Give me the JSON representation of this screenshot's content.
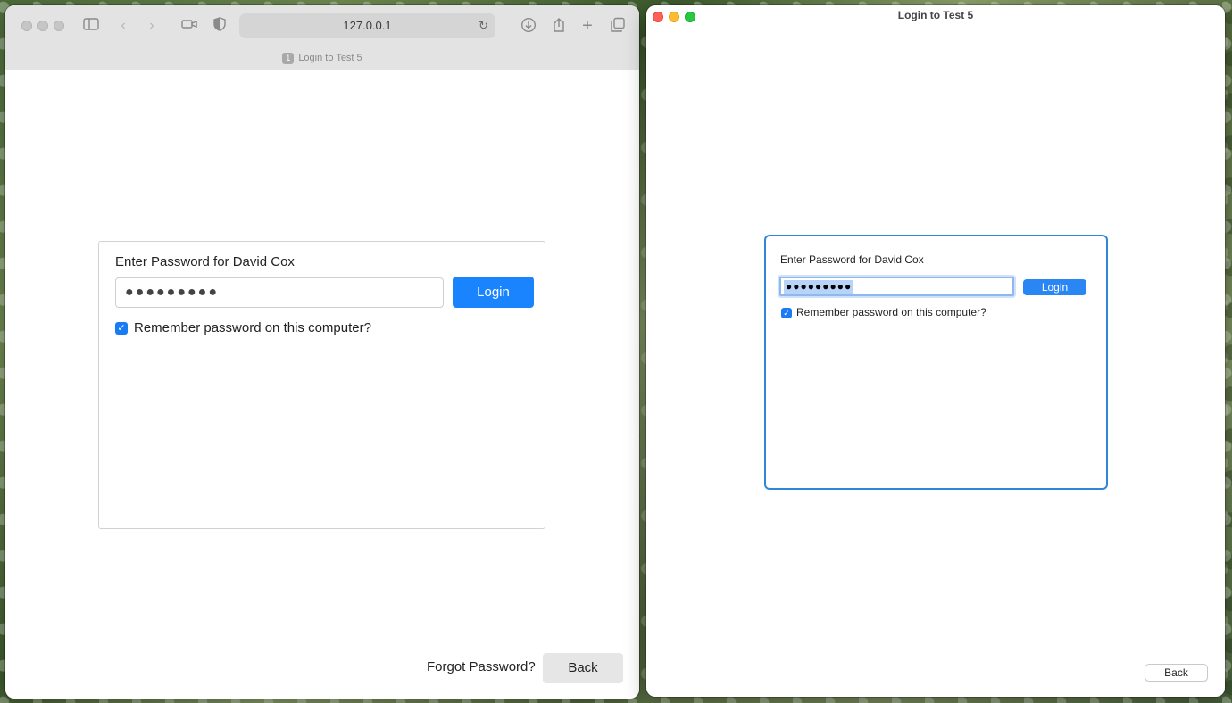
{
  "browser": {
    "url": "127.0.0.1",
    "tab": {
      "number": "1",
      "title": "Login to Test 5"
    },
    "toolbar_icons": [
      "sidebar-icon",
      "back-icon",
      "forward-icon",
      "camera-icon",
      "shield-icon",
      "reload-icon",
      "download-icon",
      "share-icon",
      "new-tab-icon",
      "tabs-overview-icon"
    ],
    "content": {
      "prompt": "Enter Password for David Cox",
      "password_value": "●●●●●●●●●",
      "login_label": "Login",
      "remember_label": "Remember password on this computer?",
      "remember_checked": true,
      "forgot_label": "Forgot Password?",
      "back_label": "Back"
    }
  },
  "native": {
    "title": "Login to Test 5",
    "prompt": "Enter Password for David Cox",
    "password_value": "●●●●●●●●●",
    "login_label": "Login",
    "remember_label": "Remember password on this computer?",
    "remember_checked": true,
    "back_label": "Back",
    "traffic_light_colors": {
      "close": "#ff5f57",
      "minimize": "#febc2e",
      "zoom": "#28c840"
    }
  },
  "colors": {
    "accent": "#1a84ff",
    "focus_border": "#2f87d8"
  }
}
